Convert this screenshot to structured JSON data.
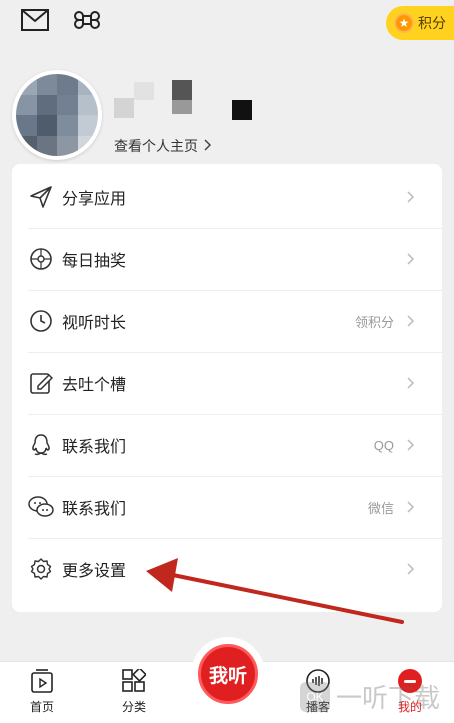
{
  "header": {
    "points_label": "积分"
  },
  "profile": {
    "view_homepage_label": "查看个人主页"
  },
  "menu": {
    "items": [
      {
        "label": "分享应用",
        "hint": "",
        "icon": "share-icon"
      },
      {
        "label": "每日抽奖",
        "hint": "",
        "icon": "lottery-wheel-icon"
      },
      {
        "label": "视听时长",
        "hint": "领积分",
        "icon": "clock-icon"
      },
      {
        "label": "去吐个槽",
        "hint": "",
        "icon": "edit-feedback-icon"
      },
      {
        "label": "联系我们",
        "hint": "QQ",
        "icon": "qq-icon"
      },
      {
        "label": "联系我们",
        "hint": "微信",
        "icon": "wechat-icon"
      },
      {
        "label": "更多设置",
        "hint": "",
        "icon": "settings-gear-icon"
      }
    ]
  },
  "tabs": [
    {
      "label": "首页",
      "icon": "home-play-icon"
    },
    {
      "label": "分类",
      "icon": "category-grid-icon"
    },
    {
      "label": "我听",
      "icon": "center-listen-button"
    },
    {
      "label": "播客",
      "icon": "podcast-icon"
    },
    {
      "label": "我的",
      "icon": "profile-icon"
    }
  ],
  "watermark": {
    "text": "一听下载",
    "logo_text": "OK"
  },
  "colors": {
    "accent_yellow": "#ffd21f",
    "brand_red": "#e02020",
    "annotation_red": "#c0281e"
  }
}
